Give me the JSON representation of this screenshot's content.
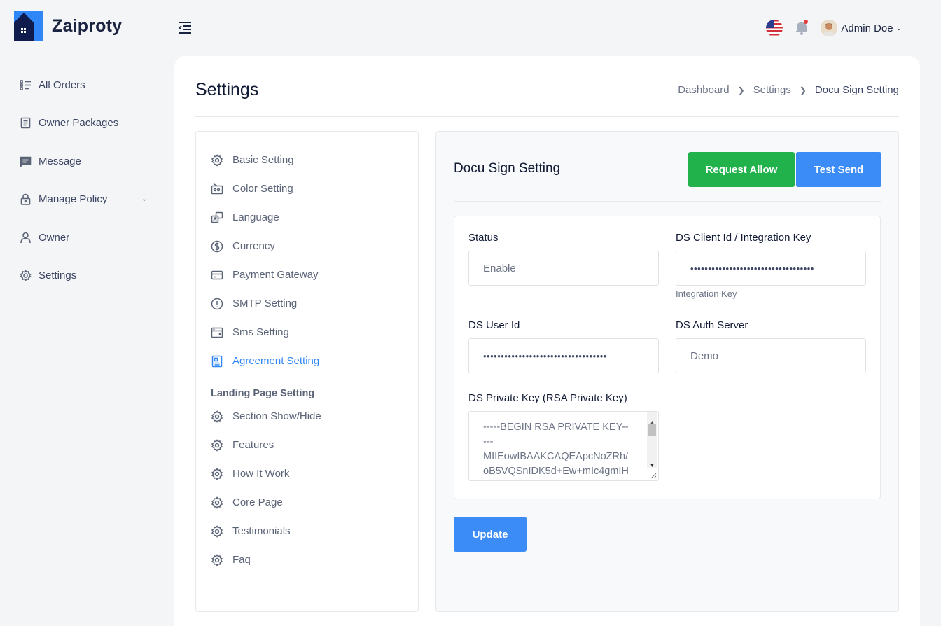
{
  "app": {
    "brand": "Zaiproty"
  },
  "header": {
    "user_name": "Admin Doe"
  },
  "sidebar": {
    "items": [
      {
        "label": "All Orders",
        "icon": "list-icon"
      },
      {
        "label": "Owner Packages",
        "icon": "document-icon"
      },
      {
        "label": "Message",
        "icon": "message-icon"
      },
      {
        "label": "Manage Policy",
        "icon": "lock-icon"
      },
      {
        "label": "Owner",
        "icon": "user-icon"
      },
      {
        "label": "Settings",
        "icon": "gear-icon"
      }
    ]
  },
  "page": {
    "title": "Settings",
    "breadcrumb": [
      "Dashboard",
      "Settings",
      "Docu Sign Setting"
    ]
  },
  "settings_menu": {
    "items": [
      {
        "label": "Basic Setting",
        "icon": "gear-icon"
      },
      {
        "label": "Color Setting",
        "icon": "palette-icon"
      },
      {
        "label": "Language",
        "icon": "language-icon"
      },
      {
        "label": "Currency",
        "icon": "dollar-icon"
      },
      {
        "label": "Payment Gateway",
        "icon": "card-icon"
      },
      {
        "label": "SMTP Setting",
        "icon": "alert-icon"
      },
      {
        "label": "Sms Setting",
        "icon": "sms-icon"
      },
      {
        "label": "Agreement Setting",
        "icon": "agreement-icon",
        "active": true
      }
    ],
    "landing_heading": "Landing Page Setting",
    "landing_items": [
      {
        "label": "Section Show/Hide"
      },
      {
        "label": "Features"
      },
      {
        "label": "How It Work"
      },
      {
        "label": "Core Page"
      },
      {
        "label": "Testimonials"
      },
      {
        "label": "Faq"
      }
    ]
  },
  "docu": {
    "title": "Docu Sign Setting",
    "request_allow_label": "Request Allow",
    "test_send_label": "Test Send",
    "status_label": "Status",
    "status_value": "Enable",
    "client_id_label": "DS Client Id / Integration Key",
    "client_id_value": "•••••••••••••••••••••••••••••••••••",
    "client_id_help": "Integration Key",
    "user_id_label": "DS User Id",
    "user_id_value": "•••••••••••••••••••••••••••••••••••",
    "auth_server_label": "DS Auth Server",
    "auth_server_value": "Demo",
    "private_key_label": "DS Private Key (RSA Private Key)",
    "private_key_value": "-----BEGIN RSA PRIVATE KEY-----\nMIIEowIBAAKCAQEApcNoZRh/oB5VQSnIDK5d+Ew+mIc4gmIHk",
    "update_label": "Update"
  },
  "colors": {
    "primary": "#3b8cf6",
    "success": "#22b24c",
    "brand_dark": "#0f1c4d"
  }
}
